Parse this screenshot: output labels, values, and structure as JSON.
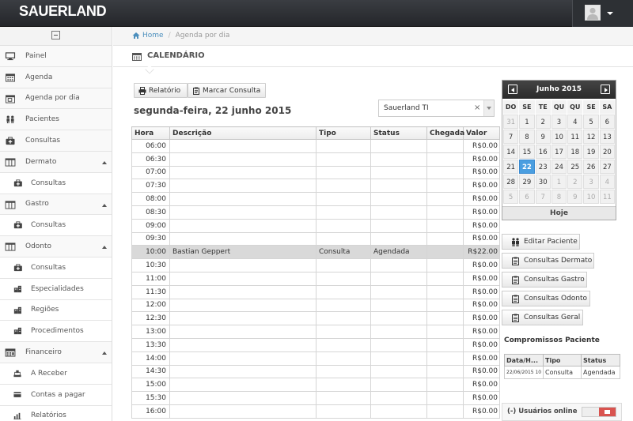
{
  "brand": "SAUERLAND",
  "breadcrumb": {
    "home": "Home",
    "current": "Agenda por dia"
  },
  "page": {
    "title": "CALENDÁRIO"
  },
  "sidebar": {
    "items": [
      {
        "label": "Painel",
        "icon": "monitor-icon",
        "sub": false
      },
      {
        "label": "Agenda",
        "icon": "calendar-icon",
        "sub": false
      },
      {
        "label": "Agenda por dia",
        "icon": "calendar-day-icon",
        "sub": false
      },
      {
        "label": "Pacientes",
        "icon": "users-icon",
        "sub": false
      },
      {
        "label": "Consultas",
        "icon": "medkit-icon",
        "sub": false
      },
      {
        "label": "Dermato",
        "icon": "columns-icon",
        "sub": false,
        "expanded": true
      },
      {
        "label": "Consultas",
        "icon": "medkit-icon",
        "sub": true
      },
      {
        "label": "Gastro",
        "icon": "columns-icon",
        "sub": false,
        "expanded": true
      },
      {
        "label": "Consultas",
        "icon": "medkit-icon",
        "sub": true
      },
      {
        "label": "Odonto",
        "icon": "columns-icon",
        "sub": false,
        "expanded": true
      },
      {
        "label": "Consultas",
        "icon": "medkit-icon",
        "sub": true
      },
      {
        "label": "Especialidades",
        "icon": "building-icon",
        "sub": true
      },
      {
        "label": "Regiões",
        "icon": "building-icon",
        "sub": true
      },
      {
        "label": "Procedimentos",
        "icon": "building-icon",
        "sub": true
      },
      {
        "label": "Financeiro",
        "icon": "calculator-icon",
        "sub": false,
        "expanded": true
      },
      {
        "label": "A Receber",
        "icon": "tray-icon",
        "sub": true
      },
      {
        "label": "Contas a pagar",
        "icon": "credit-card-icon",
        "sub": true
      },
      {
        "label": "Relatórios",
        "icon": "bar-chart-icon",
        "sub": true
      }
    ]
  },
  "toolbar": {
    "report_label": "Relatório",
    "schedule_label": "Marcar Consulta"
  },
  "day_title": "segunda-feira, 22 junho 2015",
  "select": {
    "value": "Sauerland TI",
    "clear": "×"
  },
  "agenda": {
    "headers": [
      "Hora",
      "Descrição",
      "Tipo",
      "Status",
      "Chegada",
      "Valor"
    ],
    "rows": [
      {
        "hora": "06:00",
        "descricao": "",
        "tipo": "",
        "status": "",
        "chegada": "",
        "valor": "R$0.00"
      },
      {
        "hora": "06:30",
        "descricao": "",
        "tipo": "",
        "status": "",
        "chegada": "",
        "valor": "R$0.00"
      },
      {
        "hora": "07:00",
        "descricao": "",
        "tipo": "",
        "status": "",
        "chegada": "",
        "valor": "R$0.00"
      },
      {
        "hora": "07:30",
        "descricao": "",
        "tipo": "",
        "status": "",
        "chegada": "",
        "valor": "R$0.00"
      },
      {
        "hora": "08:00",
        "descricao": "",
        "tipo": "",
        "status": "",
        "chegada": "",
        "valor": "R$0.00"
      },
      {
        "hora": "08:30",
        "descricao": "",
        "tipo": "",
        "status": "",
        "chegada": "",
        "valor": "R$0.00"
      },
      {
        "hora": "09:00",
        "descricao": "",
        "tipo": "",
        "status": "",
        "chegada": "",
        "valor": "R$0.00"
      },
      {
        "hora": "09:30",
        "descricao": "",
        "tipo": "",
        "status": "",
        "chegada": "",
        "valor": "R$0.00"
      },
      {
        "hora": "10:00",
        "descricao": "Bastian Geppert",
        "tipo": "Consulta",
        "status": "Agendada",
        "chegada": "",
        "valor": "R$22.00",
        "busy": true
      },
      {
        "hora": "10:30",
        "descricao": "",
        "tipo": "",
        "status": "",
        "chegada": "",
        "valor": "R$0.00"
      },
      {
        "hora": "11:00",
        "descricao": "",
        "tipo": "",
        "status": "",
        "chegada": "",
        "valor": "R$0.00"
      },
      {
        "hora": "11:30",
        "descricao": "",
        "tipo": "",
        "status": "",
        "chegada": "",
        "valor": "R$0.00"
      },
      {
        "hora": "12:00",
        "descricao": "",
        "tipo": "",
        "status": "",
        "chegada": "",
        "valor": "R$0.00"
      },
      {
        "hora": "12:30",
        "descricao": "",
        "tipo": "",
        "status": "",
        "chegada": "",
        "valor": "R$0.00"
      },
      {
        "hora": "13:00",
        "descricao": "",
        "tipo": "",
        "status": "",
        "chegada": "",
        "valor": "R$0.00"
      },
      {
        "hora": "13:30",
        "descricao": "",
        "tipo": "",
        "status": "",
        "chegada": "",
        "valor": "R$0.00"
      },
      {
        "hora": "14:00",
        "descricao": "",
        "tipo": "",
        "status": "",
        "chegada": "",
        "valor": "R$0.00"
      },
      {
        "hora": "14:30",
        "descricao": "",
        "tipo": "",
        "status": "",
        "chegada": "",
        "valor": "R$0.00"
      },
      {
        "hora": "15:00",
        "descricao": "",
        "tipo": "",
        "status": "",
        "chegada": "",
        "valor": "R$0.00"
      },
      {
        "hora": "15:30",
        "descricao": "",
        "tipo": "",
        "status": "",
        "chegada": "",
        "valor": "R$0.00"
      },
      {
        "hora": "16:00",
        "descricao": "",
        "tipo": "",
        "status": "",
        "chegada": "",
        "valor": "R$0.00"
      }
    ]
  },
  "calendar": {
    "month_label": "Junho 2015",
    "weekdays": [
      "DO",
      "SE",
      "TE",
      "QU",
      "QU",
      "SE",
      "SA"
    ],
    "days": [
      {
        "d": "31",
        "o": true
      },
      {
        "d": "1"
      },
      {
        "d": "2"
      },
      {
        "d": "3"
      },
      {
        "d": "4"
      },
      {
        "d": "5"
      },
      {
        "d": "6"
      },
      {
        "d": "7"
      },
      {
        "d": "8"
      },
      {
        "d": "9"
      },
      {
        "d": "10"
      },
      {
        "d": "11"
      },
      {
        "d": "12"
      },
      {
        "d": "13"
      },
      {
        "d": "14"
      },
      {
        "d": "15"
      },
      {
        "d": "16"
      },
      {
        "d": "17"
      },
      {
        "d": "18"
      },
      {
        "d": "19"
      },
      {
        "d": "20"
      },
      {
        "d": "21"
      },
      {
        "d": "22",
        "today": true
      },
      {
        "d": "23"
      },
      {
        "d": "24"
      },
      {
        "d": "25"
      },
      {
        "d": "26"
      },
      {
        "d": "27"
      },
      {
        "d": "28"
      },
      {
        "d": "29"
      },
      {
        "d": "30"
      },
      {
        "d": "1",
        "o": true
      },
      {
        "d": "2",
        "o": true
      },
      {
        "d": "3",
        "o": true
      },
      {
        "d": "4",
        "o": true
      },
      {
        "d": "5",
        "o": true
      },
      {
        "d": "6",
        "o": true
      },
      {
        "d": "7",
        "o": true
      },
      {
        "d": "8",
        "o": true
      },
      {
        "d": "9",
        "o": true
      },
      {
        "d": "10",
        "o": true
      },
      {
        "d": "11",
        "o": true
      }
    ],
    "today_label": "Hoje"
  },
  "side_buttons": {
    "edit_patient": "Editar Paciente",
    "dermato": "Consultas Dermato",
    "gastro": "Consultas Gastro",
    "odonto": "Consultas Odonto",
    "geral": "Consultas Geral"
  },
  "compromissos": {
    "title": "Compromissos Paciente",
    "headers": [
      "Data/H...",
      "Tipo",
      "Status"
    ],
    "rows": [
      {
        "data": "22/06/2015 10",
        "tipo": "Consulta",
        "status": "Agendada"
      }
    ]
  },
  "online": {
    "label": "(-) Usuários online"
  },
  "colors": {
    "topbar": "#2b2e33",
    "accent": "#4a9ee0",
    "today": "#4a9ee0",
    "toggle_on": "#d9534f",
    "busy_row": "#d9d9d9"
  }
}
